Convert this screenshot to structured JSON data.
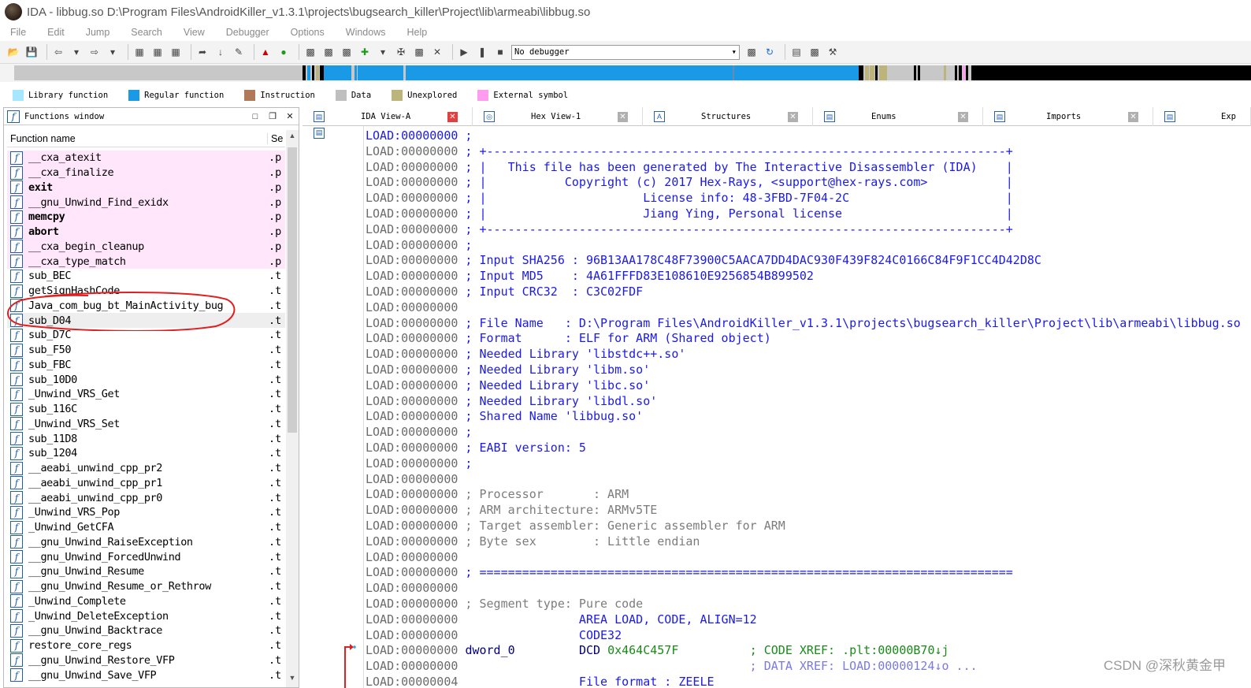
{
  "window": {
    "title": "IDA - libbug.so D:\\Program Files\\AndroidKiller_v1.3.1\\projects\\bugsearch_killer\\Project\\lib\\armeabi\\libbug.so"
  },
  "menu": [
    "File",
    "Edit",
    "Jump",
    "Search",
    "View",
    "Debugger",
    "Options",
    "Windows",
    "Help"
  ],
  "toolbar": {
    "debugger_value": "No debugger"
  },
  "legend": [
    {
      "label": "Library function",
      "color": "#a6e6ff"
    },
    {
      "label": "Regular function",
      "color": "#1a9ae6"
    },
    {
      "label": "Instruction",
      "color": "#b07a5a"
    },
    {
      "label": "Data",
      "color": "#bfbfbf"
    },
    {
      "label": "Unexplored",
      "color": "#bcb47a"
    },
    {
      "label": "External symbol",
      "color": "#ff9cf0"
    }
  ],
  "functions_window": {
    "title": "Functions window",
    "col_name": "Function name",
    "col_segment": "Se",
    "items": [
      {
        "name": "__cxa_atexit",
        "seg": ".p",
        "lib": true,
        "bold": false
      },
      {
        "name": "__cxa_finalize",
        "seg": ".p",
        "lib": true,
        "bold": false
      },
      {
        "name": "exit",
        "seg": ".p",
        "lib": true,
        "bold": true
      },
      {
        "name": "__gnu_Unwind_Find_exidx",
        "seg": ".p",
        "lib": true,
        "bold": false
      },
      {
        "name": "memcpy",
        "seg": ".p",
        "lib": true,
        "bold": true
      },
      {
        "name": "abort",
        "seg": ".p",
        "lib": true,
        "bold": true
      },
      {
        "name": "__cxa_begin_cleanup",
        "seg": ".p",
        "lib": true,
        "bold": false
      },
      {
        "name": "__cxa_type_match",
        "seg": ".p",
        "lib": true,
        "bold": false
      },
      {
        "name": "sub_BEC",
        "seg": ".t",
        "lib": false,
        "bold": false
      },
      {
        "name": "getSignHashCode",
        "seg": ".t",
        "lib": false,
        "bold": false
      },
      {
        "name": "Java_com_bug_bt_MainActivity_bug",
        "seg": ".t",
        "lib": false,
        "bold": false
      },
      {
        "name": "sub_D04",
        "seg": ".t",
        "lib": false,
        "bold": false,
        "selected": true
      },
      {
        "name": "sub_D7C",
        "seg": ".t",
        "lib": false,
        "bold": false
      },
      {
        "name": "sub_F50",
        "seg": ".t",
        "lib": false,
        "bold": false
      },
      {
        "name": "sub_FBC",
        "seg": ".t",
        "lib": false,
        "bold": false
      },
      {
        "name": "sub_10D0",
        "seg": ".t",
        "lib": false,
        "bold": false
      },
      {
        "name": "_Unwind_VRS_Get",
        "seg": ".t",
        "lib": false,
        "bold": false
      },
      {
        "name": "sub_116C",
        "seg": ".t",
        "lib": false,
        "bold": false
      },
      {
        "name": "_Unwind_VRS_Set",
        "seg": ".t",
        "lib": false,
        "bold": false
      },
      {
        "name": "sub_11D8",
        "seg": ".t",
        "lib": false,
        "bold": false
      },
      {
        "name": "sub_1204",
        "seg": ".t",
        "lib": false,
        "bold": false
      },
      {
        "name": "__aeabi_unwind_cpp_pr2",
        "seg": ".t",
        "lib": false,
        "bold": false
      },
      {
        "name": "__aeabi_unwind_cpp_pr1",
        "seg": ".t",
        "lib": false,
        "bold": false
      },
      {
        "name": "__aeabi_unwind_cpp_pr0",
        "seg": ".t",
        "lib": false,
        "bold": false
      },
      {
        "name": "_Unwind_VRS_Pop",
        "seg": ".t",
        "lib": false,
        "bold": false
      },
      {
        "name": "_Unwind_GetCFA",
        "seg": ".t",
        "lib": false,
        "bold": false
      },
      {
        "name": "__gnu_Unwind_RaiseException",
        "seg": ".t",
        "lib": false,
        "bold": false
      },
      {
        "name": "__gnu_Unwind_ForcedUnwind",
        "seg": ".t",
        "lib": false,
        "bold": false
      },
      {
        "name": "__gnu_Unwind_Resume",
        "seg": ".t",
        "lib": false,
        "bold": false
      },
      {
        "name": "__gnu_Unwind_Resume_or_Rethrow",
        "seg": ".t",
        "lib": false,
        "bold": false
      },
      {
        "name": "_Unwind_Complete",
        "seg": ".t",
        "lib": false,
        "bold": false
      },
      {
        "name": "_Unwind_DeleteException",
        "seg": ".t",
        "lib": false,
        "bold": false
      },
      {
        "name": "__gnu_Unwind_Backtrace",
        "seg": ".t",
        "lib": false,
        "bold": false
      },
      {
        "name": "restore_core_regs",
        "seg": ".t",
        "lib": false,
        "bold": false
      },
      {
        "name": "__gnu_Unwind_Restore_VFP",
        "seg": ".t",
        "lib": false,
        "bold": false
      },
      {
        "name": "__gnu_Unwind_Save_VFP",
        "seg": ".t",
        "lib": false,
        "bold": false
      }
    ]
  },
  "tabs": [
    {
      "label": "IDA View-A",
      "icon": "ida-view-icon",
      "active": true
    },
    {
      "label": "Hex View-1",
      "icon": "hex-view-icon",
      "active": false
    },
    {
      "label": "Structures",
      "icon": "structures-icon",
      "active": false
    },
    {
      "label": "Enums",
      "icon": "enums-icon",
      "active": false
    },
    {
      "label": "Imports",
      "icon": "imports-icon",
      "active": false
    },
    {
      "label": "Exp",
      "icon": "exports-icon",
      "active": false
    }
  ],
  "disassembly": [
    {
      "addr": "LOAD:00000000",
      "text": " ;",
      "style": "blue",
      "addrBlue": true
    },
    {
      "addr": "LOAD:00000000",
      "text": " ; +-------------------------------------------------------------------------+",
      "style": "blue"
    },
    {
      "addr": "LOAD:00000000",
      "text": " ; |   This file has been generated by The Interactive Disassembler (IDA)    |",
      "style": "blue"
    },
    {
      "addr": "LOAD:00000000",
      "text": " ; |           Copyright (c) 2017 Hex-Rays, <support@hex-rays.com>           |",
      "style": "blue"
    },
    {
      "addr": "LOAD:00000000",
      "text": " ; |                      License info: 48-3FBD-7F04-2C                      |",
      "style": "blue"
    },
    {
      "addr": "LOAD:00000000",
      "text": " ; |                      Jiang Ying, Personal license                       |",
      "style": "blue"
    },
    {
      "addr": "LOAD:00000000",
      "text": " ; +-------------------------------------------------------------------------+",
      "style": "blue"
    },
    {
      "addr": "LOAD:00000000",
      "text": " ;",
      "style": "blue"
    },
    {
      "addr": "LOAD:00000000",
      "text": " ; Input SHA256 : 96B13AA178C48F73900C5AACA7DD4DAC930F439F824C0166C84F9F1CC4D42D8C",
      "style": "blue"
    },
    {
      "addr": "LOAD:00000000",
      "text": " ; Input MD5    : 4A61FFFD83E108610E9256854B899502",
      "style": "blue"
    },
    {
      "addr": "LOAD:00000000",
      "text": " ; Input CRC32  : C3C02FDF",
      "style": "blue"
    },
    {
      "addr": "LOAD:00000000",
      "text": "",
      "style": "gray"
    },
    {
      "addr": "LOAD:00000000",
      "text": " ; File Name   : D:\\Program Files\\AndroidKiller_v1.3.1\\projects\\bugsearch_killer\\Project\\lib\\armeabi\\libbug.so",
      "style": "blue"
    },
    {
      "addr": "LOAD:00000000",
      "text": " ; Format      : ELF for ARM (Shared object)",
      "style": "blue"
    },
    {
      "addr": "LOAD:00000000",
      "text": " ; Needed Library 'libstdc++.so'",
      "style": "blue"
    },
    {
      "addr": "LOAD:00000000",
      "text": " ; Needed Library 'libm.so'",
      "style": "blue"
    },
    {
      "addr": "LOAD:00000000",
      "text": " ; Needed Library 'libc.so'",
      "style": "blue"
    },
    {
      "addr": "LOAD:00000000",
      "text": " ; Needed Library 'libdl.so'",
      "style": "blue"
    },
    {
      "addr": "LOAD:00000000",
      "text": " ; Shared Name 'libbug.so'",
      "style": "blue"
    },
    {
      "addr": "LOAD:00000000",
      "text": " ;",
      "style": "blue"
    },
    {
      "addr": "LOAD:00000000",
      "text": " ; EABI version: 5",
      "style": "blue"
    },
    {
      "addr": "LOAD:00000000",
      "text": " ;",
      "style": "blue"
    },
    {
      "addr": "LOAD:00000000",
      "text": "",
      "style": "gray"
    },
    {
      "addr": "LOAD:00000000",
      "text": " ; Processor       : ARM",
      "style": "gray"
    },
    {
      "addr": "LOAD:00000000",
      "text": " ; ARM architecture: ARMv5TE",
      "style": "gray"
    },
    {
      "addr": "LOAD:00000000",
      "text": " ; Target assembler: Generic assembler for ARM",
      "style": "gray"
    },
    {
      "addr": "LOAD:00000000",
      "text": " ; Byte sex        : Little endian",
      "style": "gray"
    },
    {
      "addr": "LOAD:00000000",
      "text": "",
      "style": "gray"
    },
    {
      "addr": "LOAD:00000000",
      "text": " ; ===========================================================================",
      "style": "blue"
    },
    {
      "addr": "LOAD:00000000",
      "text": "",
      "style": "gray"
    },
    {
      "addr": "LOAD:00000000",
      "text": " ; Segment type: Pure code",
      "style": "gray"
    },
    {
      "addr": "LOAD:00000000",
      "text": "                 AREA LOAD, CODE, ALIGN=12",
      "style": "blue"
    },
    {
      "addr": "LOAD:00000000",
      "text": "                 CODE32",
      "style": "blue"
    },
    {
      "addr": "LOAD:00000000",
      "text": " dword_0         DCD 0x464C457F          ; CODE XREF: .plt:00000B70↓j",
      "style": "mixed"
    },
    {
      "addr": "LOAD:00000000",
      "text": "                                         ; DATA XREF: LOAD:00000124↓o ...",
      "style": "lightblue"
    },
    {
      "addr": "LOAD:00000004",
      "text": "                 File format : ZEELE",
      "style": "blue"
    }
  ],
  "watermark": "CSDN @深秋黄金甲"
}
